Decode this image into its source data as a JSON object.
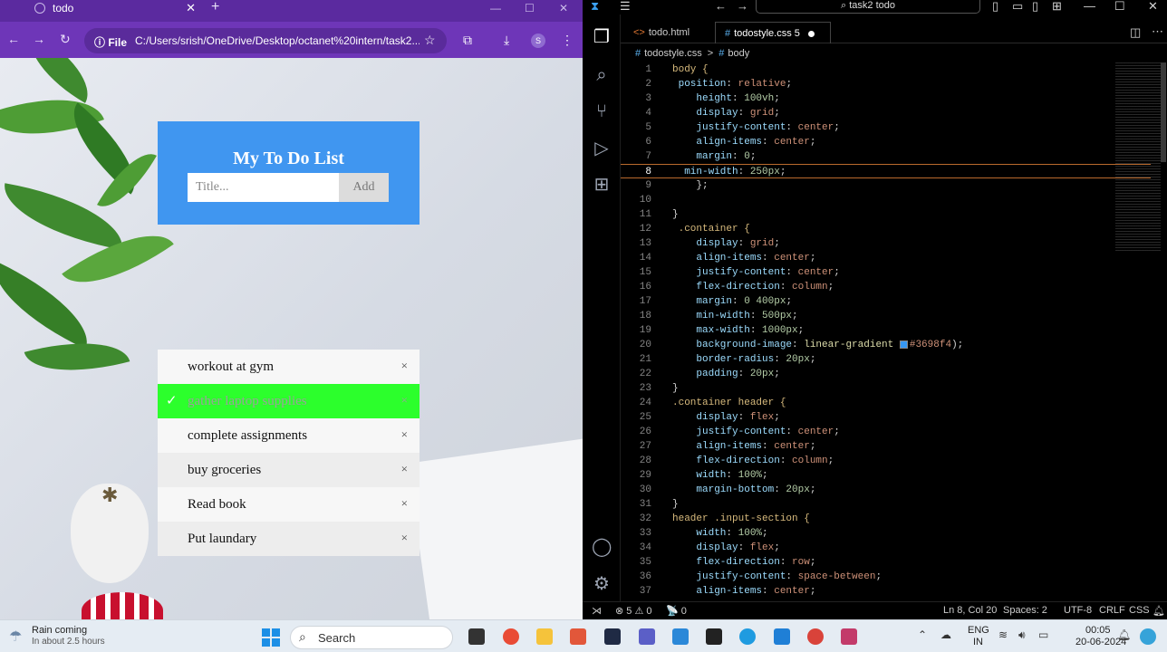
{
  "browser": {
    "tab_title": "todo",
    "address_scheme": "File",
    "address_url": "C:/Users/srish/OneDrive/Desktop/octanet%20intern/task2...",
    "profile_letter": "S"
  },
  "todo": {
    "title": "My To Do List",
    "input_placeholder": "Title...",
    "add_label": "Add",
    "items": [
      {
        "text": "workout at gym",
        "done": false
      },
      {
        "text": "gather laptop supplies",
        "done": true
      },
      {
        "text": "complete assignments",
        "done": false
      },
      {
        "text": "buy groceries",
        "done": false
      },
      {
        "text": "Read book",
        "done": false
      },
      {
        "text": "Put laundary",
        "done": false
      }
    ],
    "close_glyph": "×",
    "check_glyph": "✓"
  },
  "vscode": {
    "search_label": "task2 todo",
    "tabs": [
      {
        "label": "todo.html"
      },
      {
        "label": "todostyle.css 5"
      }
    ],
    "breadcrumb_file": "todostyle.css",
    "breadcrumb_sep": ">",
    "breadcrumb_symbol": "body",
    "status": {
      "errors": "⊗ 5 ⚠ 0",
      "ports": "📡 0",
      "position": "Ln 8, Col 20",
      "spaces": "Spaces: 2",
      "encoding": "UTF-8",
      "eol": "CRLF",
      "language": "CSS"
    }
  },
  "code_lines": [
    [
      {
        "t": "body {",
        "c": "sel"
      }
    ],
    [
      {
        "t": " position",
        "c": "prop"
      },
      {
        "t": ": ",
        "c": "punc"
      },
      {
        "t": "relative",
        "c": "val"
      },
      {
        "t": ";",
        "c": "punc"
      }
    ],
    [
      {
        "t": "    height",
        "c": "prop"
      },
      {
        "t": ": ",
        "c": "punc"
      },
      {
        "t": "100vh",
        "c": "num"
      },
      {
        "t": ";",
        "c": "punc"
      }
    ],
    [
      {
        "t": "    display",
        "c": "prop"
      },
      {
        "t": ": ",
        "c": "punc"
      },
      {
        "t": "grid",
        "c": "val"
      },
      {
        "t": ";",
        "c": "punc"
      }
    ],
    [
      {
        "t": "    justify-content",
        "c": "prop"
      },
      {
        "t": ": ",
        "c": "punc"
      },
      {
        "t": "center",
        "c": "val"
      },
      {
        "t": ";",
        "c": "punc"
      }
    ],
    [
      {
        "t": "    align-items",
        "c": "prop"
      },
      {
        "t": ": ",
        "c": "punc"
      },
      {
        "t": "center",
        "c": "val"
      },
      {
        "t": ";",
        "c": "punc"
      }
    ],
    [
      {
        "t": "    margin",
        "c": "prop"
      },
      {
        "t": ": ",
        "c": "punc"
      },
      {
        "t": "0",
        "c": "num"
      },
      {
        "t": ";",
        "c": "punc"
      }
    ],
    [
      {
        "t": "  min-width",
        "c": "prop"
      },
      {
        "t": ": ",
        "c": "punc"
      },
      {
        "t": "250px",
        "c": "num"
      },
      {
        "t": ";",
        "c": "punc"
      }
    ],
    [
      {
        "t": "    };",
        "c": "punc"
      }
    ],
    [],
    [
      {
        "t": "}",
        "c": "punc"
      }
    ],
    [
      {
        "t": " .container {",
        "c": "sel"
      }
    ],
    [
      {
        "t": "    display",
        "c": "prop"
      },
      {
        "t": ": ",
        "c": "punc"
      },
      {
        "t": "grid",
        "c": "val"
      },
      {
        "t": ";",
        "c": "punc"
      }
    ],
    [
      {
        "t": "    align-items",
        "c": "prop"
      },
      {
        "t": ": ",
        "c": "punc"
      },
      {
        "t": "center",
        "c": "val"
      },
      {
        "t": ";",
        "c": "punc"
      }
    ],
    [
      {
        "t": "    justify-content",
        "c": "prop"
      },
      {
        "t": ": ",
        "c": "punc"
      },
      {
        "t": "center",
        "c": "val"
      },
      {
        "t": ";",
        "c": "punc"
      }
    ],
    [
      {
        "t": "    flex-direction",
        "c": "prop"
      },
      {
        "t": ": ",
        "c": "punc"
      },
      {
        "t": "column",
        "c": "val"
      },
      {
        "t": ";",
        "c": "punc"
      }
    ],
    [
      {
        "t": "    margin",
        "c": "prop"
      },
      {
        "t": ": ",
        "c": "punc"
      },
      {
        "t": "0 400px",
        "c": "num"
      },
      {
        "t": ";",
        "c": "punc"
      }
    ],
    [
      {
        "t": "    min-width",
        "c": "prop"
      },
      {
        "t": ": ",
        "c": "punc"
      },
      {
        "t": "500px",
        "c": "num"
      },
      {
        "t": ";",
        "c": "punc"
      }
    ],
    [
      {
        "t": "    max-width",
        "c": "prop"
      },
      {
        "t": ": ",
        "c": "punc"
      },
      {
        "t": "1000px",
        "c": "num"
      },
      {
        "t": ";",
        "c": "punc"
      }
    ],
    [
      {
        "t": "    background-image",
        "c": "prop"
      },
      {
        "t": ": ",
        "c": "punc"
      },
      {
        "t": "linear-gradient ",
        "c": "fn"
      },
      {
        "t": "■",
        "c": "swatch"
      },
      {
        "t": "#3698f4",
        "c": "val"
      },
      {
        "t": ");",
        "c": "punc"
      }
    ],
    [
      {
        "t": "    border-radius",
        "c": "prop"
      },
      {
        "t": ": ",
        "c": "punc"
      },
      {
        "t": "20px",
        "c": "num"
      },
      {
        "t": ";",
        "c": "punc"
      }
    ],
    [
      {
        "t": "    padding",
        "c": "prop"
      },
      {
        "t": ": ",
        "c": "punc"
      },
      {
        "t": "20px",
        "c": "num"
      },
      {
        "t": ";",
        "c": "punc"
      }
    ],
    [
      {
        "t": "}",
        "c": "punc"
      }
    ],
    [
      {
        "t": ".container header {",
        "c": "sel"
      }
    ],
    [
      {
        "t": "    display",
        "c": "prop"
      },
      {
        "t": ": ",
        "c": "punc"
      },
      {
        "t": "flex",
        "c": "val"
      },
      {
        "t": ";",
        "c": "punc"
      }
    ],
    [
      {
        "t": "    justify-content",
        "c": "prop"
      },
      {
        "t": ": ",
        "c": "punc"
      },
      {
        "t": "center",
        "c": "val"
      },
      {
        "t": ";",
        "c": "punc"
      }
    ],
    [
      {
        "t": "    align-items",
        "c": "prop"
      },
      {
        "t": ": ",
        "c": "punc"
      },
      {
        "t": "center",
        "c": "val"
      },
      {
        "t": ";",
        "c": "punc"
      }
    ],
    [
      {
        "t": "    flex-direction",
        "c": "prop"
      },
      {
        "t": ": ",
        "c": "punc"
      },
      {
        "t": "column",
        "c": "val"
      },
      {
        "t": ";",
        "c": "punc"
      }
    ],
    [
      {
        "t": "    width",
        "c": "prop"
      },
      {
        "t": ": ",
        "c": "punc"
      },
      {
        "t": "100%",
        "c": "num"
      },
      {
        "t": ";",
        "c": "punc"
      }
    ],
    [
      {
        "t": "    margin-bottom",
        "c": "prop"
      },
      {
        "t": ": ",
        "c": "punc"
      },
      {
        "t": "20px",
        "c": "num"
      },
      {
        "t": ";",
        "c": "punc"
      }
    ],
    [
      {
        "t": "}",
        "c": "punc"
      }
    ],
    [
      {
        "t": "header .input-section {",
        "c": "sel"
      }
    ],
    [
      {
        "t": "    width",
        "c": "prop"
      },
      {
        "t": ": ",
        "c": "punc"
      },
      {
        "t": "100%",
        "c": "num"
      },
      {
        "t": ";",
        "c": "punc"
      }
    ],
    [
      {
        "t": "    display",
        "c": "prop"
      },
      {
        "t": ": ",
        "c": "punc"
      },
      {
        "t": "flex",
        "c": "val"
      },
      {
        "t": ";",
        "c": "punc"
      }
    ],
    [
      {
        "t": "    flex-direction",
        "c": "prop"
      },
      {
        "t": ": ",
        "c": "punc"
      },
      {
        "t": "row",
        "c": "val"
      },
      {
        "t": ";",
        "c": "punc"
      }
    ],
    [
      {
        "t": "    justify-content",
        "c": "prop"
      },
      {
        "t": ": ",
        "c": "punc"
      },
      {
        "t": "space-between",
        "c": "val"
      },
      {
        "t": ";",
        "c": "punc"
      }
    ],
    [
      {
        "t": "    align-items",
        "c": "prop"
      },
      {
        "t": ": ",
        "c": "punc"
      },
      {
        "t": "center",
        "c": "val"
      },
      {
        "t": ";",
        "c": "punc"
      }
    ]
  ],
  "current_line": 8,
  "taskbar": {
    "weather_title": "Rain coming",
    "weather_sub": "In about 2.5 hours",
    "search_label": "Search",
    "lang_top": "ENG",
    "lang_bottom": "IN",
    "time": "00:05",
    "date": "20-06-2024"
  },
  "colors": {
    "browser_chrome": "#6e36b8",
    "todo_header": "#4096f0",
    "done_item": "#2cff2c",
    "vscode_bg": "#000000"
  }
}
